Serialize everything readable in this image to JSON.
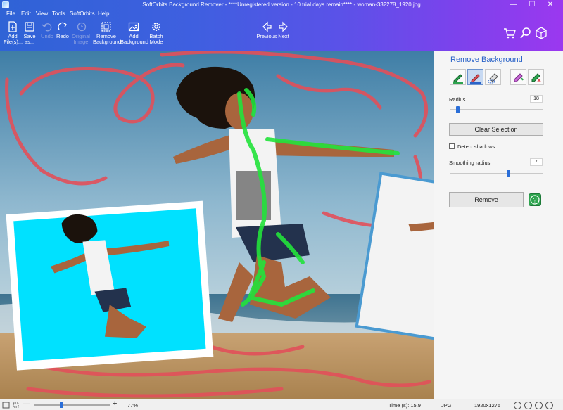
{
  "window": {
    "title": "SoftOrbits Background Remover - ****Unregistered version - 10 trial days remain**** - woman-332278_1920.jpg",
    "minimize": "—",
    "maximize": "☐",
    "close": "✕"
  },
  "menu": [
    "File",
    "Edit",
    "View",
    "Tools",
    "SoftOrbits",
    "Help"
  ],
  "toolbar": {
    "add_files": "Add\nFile(s)...",
    "save_as": "Save\nas...",
    "undo": "Undo",
    "redo": "Redo",
    "restore_original": "Original\nImage",
    "remove_background": "Remove\nBackground",
    "add_background": "Add\nBackground",
    "batch_mode": "Batch\nMode",
    "previous": "Previous",
    "next": "Next"
  },
  "header_icons": [
    "cart-icon",
    "search-icon",
    "box-icon"
  ],
  "panel": {
    "title": "Remove Background",
    "tools": [
      "keep-marker-icon",
      "remove-marker-icon",
      "lasso-eraser-icon",
      "auto-select-icon",
      "auto-remove-icon"
    ],
    "radius_label": "Radius",
    "radius_value": "18",
    "radius_level": 0.07,
    "clear_selection": "Clear Selection",
    "detect_shadows": "Detect shadows",
    "detect_shadows_checked": false,
    "smoothing_label": "Smoothing radius",
    "smoothing_value": "7",
    "smoothing_level": 0.64,
    "remove": "Remove",
    "help": "?"
  },
  "status": {
    "zoom": "77%",
    "zoom_level": 0.36,
    "time": "Time (s): 15.9",
    "format": "JPG",
    "size": "1920x1275",
    "social": [
      "info-icon",
      "facebook-icon",
      "twitter-icon",
      "youtube-icon"
    ]
  },
  "colors": {
    "accent": "#2a6ed8",
    "keep_stroke": "#22e33b",
    "remove_stroke": "#e2505a",
    "cyan_bg": "#00e1ff",
    "help_green": "#2ea44f"
  }
}
